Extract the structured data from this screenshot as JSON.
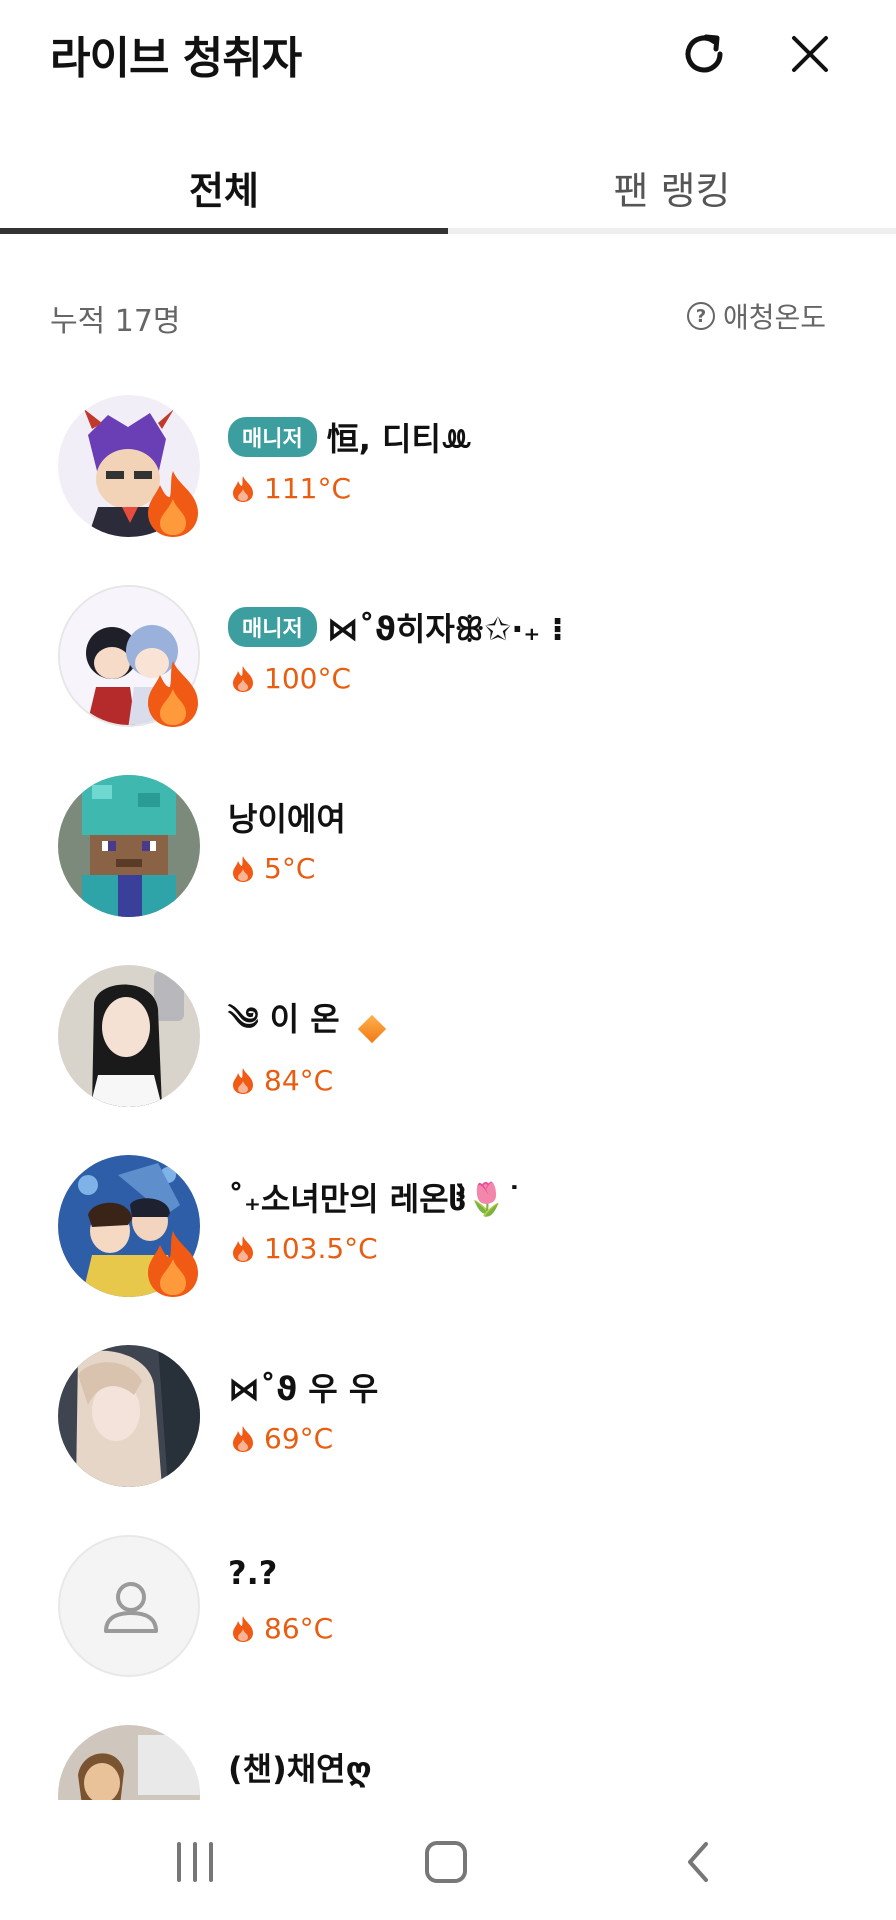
{
  "header": {
    "title": "라이브 청취자",
    "refresh_icon": "refresh-icon",
    "close_icon": "close-icon"
  },
  "tabs": [
    {
      "label": "전체",
      "active": true
    },
    {
      "label": "팬 랭킹",
      "active": false
    }
  ],
  "summary": {
    "total": "누적 17명",
    "affection_label": "애청온도",
    "help_icon": "question-circle-icon"
  },
  "colors": {
    "accent_badge": "#3d9ea0",
    "temperature": "#e85d10",
    "tab_active": "#333333"
  },
  "listeners": [
    {
      "name": "恒, 디티ꔛ",
      "badge": "매니저",
      "temp": "111°C",
      "flame_badge": true
    },
    {
      "name": "⋈˚ϑ히자ꕥ✩·₊   ⁝",
      "badge": "매니저",
      "temp": "100°C",
      "flame_badge": true
    },
    {
      "name": "낭이에여",
      "badge": "",
      "temp": "5°C",
      "flame_badge": false
    },
    {
      "name": "༄ 이 온",
      "badge": "",
      "temp": "84°C",
      "flame_badge": false,
      "diamond": true
    },
    {
      "name": "˚₊소녀만의 레온ჱ̒🌷˙",
      "badge": "",
      "temp": "103.5°C",
      "flame_badge": true
    },
    {
      "name": "⋈˚ϑ 우 우",
      "badge": "",
      "temp": "69°C",
      "flame_badge": false
    },
    {
      "name": "?.?",
      "badge": "",
      "temp": "86°C",
      "flame_badge": false,
      "default_avatar": true
    },
    {
      "name": "(챈)채연ღ",
      "badge": "",
      "temp": "",
      "flame_badge": false
    }
  ],
  "navbar": {
    "recent_icon": "recent-apps-icon",
    "home_icon": "home-icon",
    "back_icon": "back-icon"
  }
}
